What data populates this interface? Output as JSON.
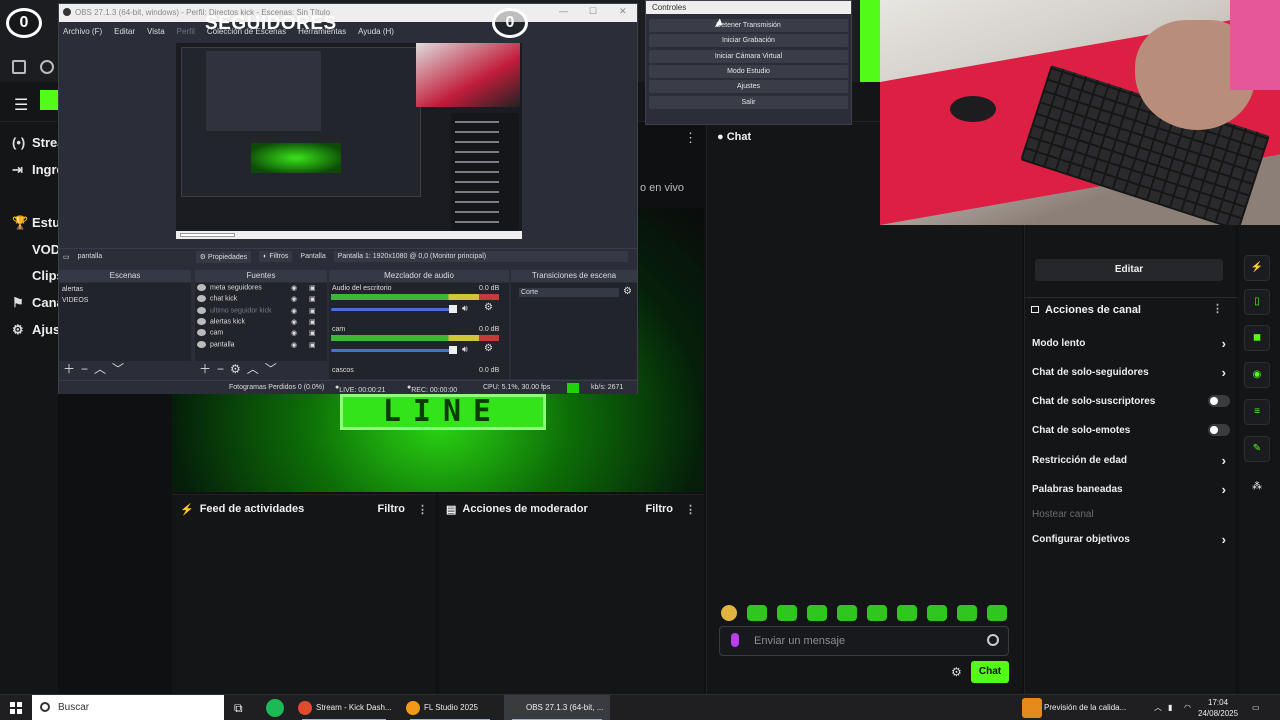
{
  "overlay": {
    "counter_left": "0",
    "counter_right": "0",
    "label": "SEGUIDORES"
  },
  "obs": {
    "window_title": "OBS 27.1.3 (64-bit, windows) - Perfil: Directos kick - Escenas: Sin Título",
    "menu": [
      "Archivo (F)",
      "Editar",
      "Vista",
      "Perfil",
      "Colección de Escenas",
      "Herramientas",
      "Ayuda (H)"
    ],
    "source_bar": {
      "source": "pantalla",
      "properties": "Propiedades",
      "filters": "Filtros",
      "display_label": "Pantalla",
      "display_value": "Pantalla 1: 1920x1080 @ 0,0 (Monitor principal)"
    },
    "docks": {
      "scenes_title": "Escenas",
      "sources_title": "Fuentes",
      "mixer_title": "Mezclador de audio",
      "transitions_title": "Transiciones de escena"
    },
    "scenes": [
      "alertas",
      "VIDEOS"
    ],
    "sources": [
      {
        "name": "meta seguidores",
        "dim": false
      },
      {
        "name": "chat kick",
        "dim": false
      },
      {
        "name": "ultimo seguidor kick",
        "dim": true
      },
      {
        "name": "alertas kick",
        "dim": false
      },
      {
        "name": "cam",
        "dim": false
      },
      {
        "name": "pantalla",
        "dim": false
      }
    ],
    "mixer": [
      {
        "name": "Audio del escritorio",
        "db": "0.0 dB"
      },
      {
        "name": "cam",
        "db": "0.0 dB"
      },
      {
        "name": "cascos",
        "db": "0.0 dB"
      }
    ],
    "transition": "Corte",
    "status": {
      "dropped": "Fotogramas Perdidos 0 (0.0%)",
      "live": "LIVE: 00:00:21",
      "rec": "REC: 00:00:00",
      "cpu": "CPU: 5.1%, 30.00 fps",
      "kbps": "kb/s: 2671"
    }
  },
  "controls": {
    "title": "Controles",
    "buttons": [
      "Detener Transmisión",
      "Iniciar Grabación",
      "Iniciar Cámara Virtual",
      "Modo Estudio",
      "Ajustes",
      "Salir"
    ]
  },
  "kick": {
    "sidebar": [
      {
        "icon": "(•)",
        "label": "Strea"
      },
      {
        "icon": "⇥",
        "label": "Ingre"
      },
      {
        "icon": "🏆",
        "label": "Estu"
      },
      {
        "icon": "",
        "label": "VOD"
      },
      {
        "icon": "",
        "label": "Clips"
      },
      {
        "icon": "⚑",
        "label": "Cana"
      },
      {
        "icon": "⚙",
        "label": "Ajus"
      }
    ],
    "en_vivo": "o en vivo",
    "stream_text": "LINE",
    "feed_title": "Feed de actividades",
    "feed_filter": "Filtro",
    "mod_title": "Acciones de moderador",
    "mod_filter": "Filtro",
    "chat_title": "Chat",
    "chat_placeholder": "Enviar un mensaje",
    "chat_button": "Chat",
    "edit_button": "Editar",
    "channel_actions_title": "Acciones de canal",
    "settings": [
      {
        "label": "Modo lento",
        "kind": "chevron",
        "muted": false
      },
      {
        "label": "Chat de solo-seguidores",
        "kind": "chevron",
        "muted": false
      },
      {
        "label": "Chat de solo-suscriptores",
        "kind": "toggle",
        "muted": false
      },
      {
        "label": "Chat de solo-emotes",
        "kind": "toggle",
        "muted": false
      },
      {
        "label": "Restricción de edad",
        "kind": "chevron",
        "muted": false
      },
      {
        "label": "Palabras baneadas",
        "kind": "chevron",
        "muted": false
      },
      {
        "label": "Hostear canal",
        "kind": "none",
        "muted": true
      },
      {
        "label": "Configurar objetivos",
        "kind": "chevron",
        "muted": false
      }
    ]
  },
  "taskbar": {
    "search": "Buscar",
    "apps": [
      {
        "label": "Stream - Kick Dash...",
        "color": "#e04a2f",
        "active": false
      },
      {
        "label": "FL Studio 2025",
        "color": "#f19a1a",
        "active": false
      },
      {
        "label": "OBS 27.1.3 (64-bit, ...",
        "color": "#3b3b3b",
        "active": true
      }
    ],
    "weather": "Previsión de la calida...",
    "time": "17:04",
    "date": "24/08/2025"
  },
  "colors": {
    "kick_green": "#53fc18",
    "obs_bg": "#2b2e38"
  }
}
